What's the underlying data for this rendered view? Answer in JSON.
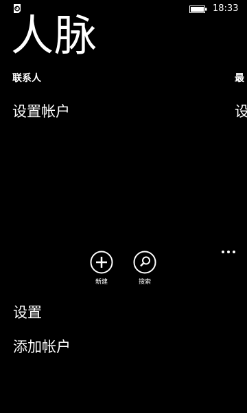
{
  "status_bar": {
    "time": "18:33",
    "left_icon": "notification-icon",
    "battery_icon": "battery-icon"
  },
  "app": {
    "title": "人脉"
  },
  "pivot": {
    "current_header": "联系人",
    "next_header_partial": "最",
    "current_link": "设置帐户",
    "next_link_partial": "设"
  },
  "app_bar": {
    "buttons": [
      {
        "label": "新建",
        "icon": "add-icon"
      },
      {
        "label": "搜索",
        "icon": "search-icon"
      }
    ],
    "more_icon": "more-icon",
    "menu_items": [
      {
        "label": "设置"
      },
      {
        "label": "添加帐户"
      }
    ]
  },
  "colors": {
    "background": "#000000",
    "foreground": "#ffffff"
  }
}
